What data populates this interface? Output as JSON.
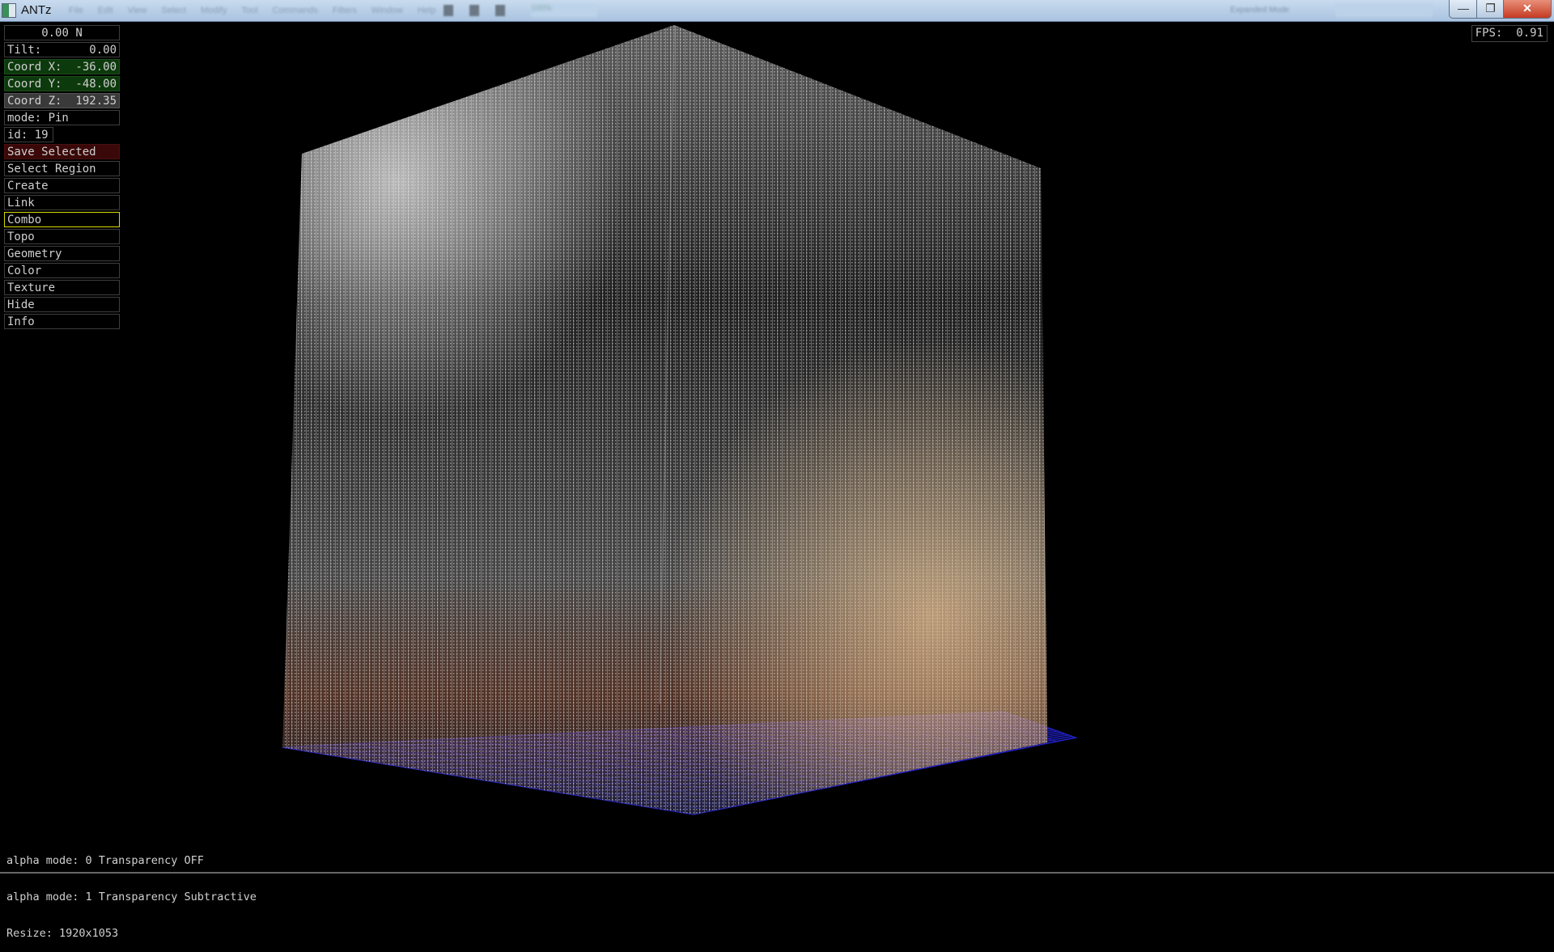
{
  "window": {
    "title": "ANTz",
    "minimize": "—",
    "maximize": "❐",
    "close": "✕"
  },
  "menu": [
    "File",
    "Edit",
    "View",
    "Select",
    "Modify",
    "Tool",
    "Commands",
    "Filters",
    "Window",
    "Help"
  ],
  "toolbar": {
    "zoom": "100%",
    "mode": "Expanded Mode"
  },
  "panel": {
    "heading": "0.00 N",
    "tilt_label": "Tilt:",
    "tilt_value": "0.00",
    "coord_x_label": "Coord X:",
    "coord_x": "-36.00",
    "coord_y_label": "Coord Y:",
    "coord_y": "-48.00",
    "coord_z_label": "Coord Z:",
    "coord_z": "192.35",
    "mode": "mode: Pin",
    "id": "id: 19",
    "buttons": [
      "Save Selected",
      "Select Region",
      "Create",
      "Link",
      "Combo",
      "Topo",
      "Geometry",
      "Color",
      "Texture",
      "Hide",
      "Info"
    ]
  },
  "fps": "FPS:  0.91",
  "log": [
    "alpha mode: 0 Transparency OFF",
    "alpha mode: 1 Transparency Subtractive",
    "Resize: 1920x1053"
  ],
  "colors": {
    "grid": "#2020c0",
    "selected_border": "#d8d800",
    "save_bg": "#3a0808",
    "coord_bg": "#0d3a0d"
  }
}
